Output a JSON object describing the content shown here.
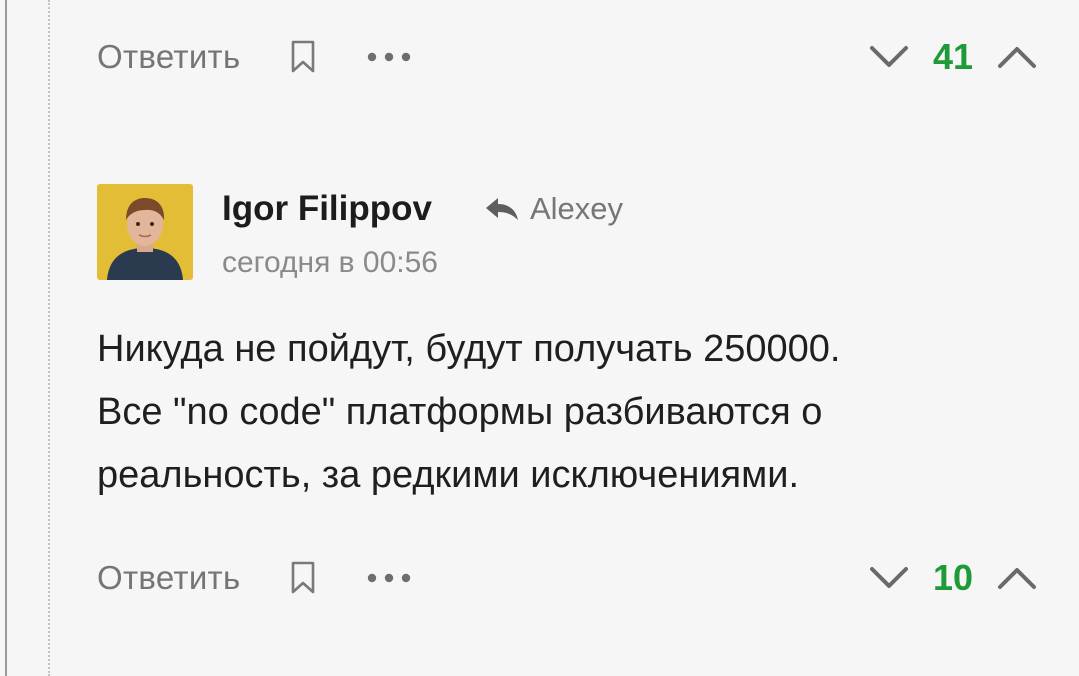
{
  "prev_comment": {
    "actions": {
      "reply_label": "Ответить",
      "score": "41"
    }
  },
  "comment": {
    "author": "Igor Filippov",
    "reply_to": "Alexey",
    "timestamp": "сегодня в 00:56",
    "text_lines": [
      "Никуда не пойдут, будут получать 250000.",
      "Все \"no code\" платформы разбиваются о",
      "реальность, за редкими исключениями."
    ],
    "actions": {
      "reply_label": "Ответить",
      "score": "10"
    }
  },
  "icons": {
    "bookmark": "bookmark-icon",
    "more": "more-dots-icon",
    "vote_down": "chevron-down-icon",
    "vote_up": "chevron-up-icon",
    "reply_arrow": "reply-arrow-icon"
  },
  "colors": {
    "score_positive": "#1e9a38",
    "background": "#f6f6f6",
    "secondary_text": "#757575",
    "avatar_background": "#e7c23a"
  }
}
